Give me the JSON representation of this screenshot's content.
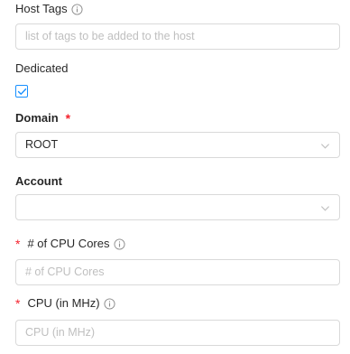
{
  "host_tags": {
    "label": "Host Tags",
    "placeholder": "list of tags to be added to the host"
  },
  "dedicated": {
    "label": "Dedicated",
    "checked": true
  },
  "domain": {
    "label": "Domain",
    "required_mark": "*",
    "value": "ROOT"
  },
  "account": {
    "label": "Account",
    "value": ""
  },
  "cpu_cores": {
    "required_mark": "*",
    "label": "# of CPU Cores",
    "placeholder": "# of CPU Cores"
  },
  "cpu_mhz": {
    "required_mark": "*",
    "label": "CPU (in MHz)",
    "placeholder": "CPU (in MHz)"
  },
  "colors": {
    "accent": "#1890ff",
    "required": "#f5222d",
    "border": "#d9d9d9",
    "placeholder": "#bfbfbf"
  }
}
